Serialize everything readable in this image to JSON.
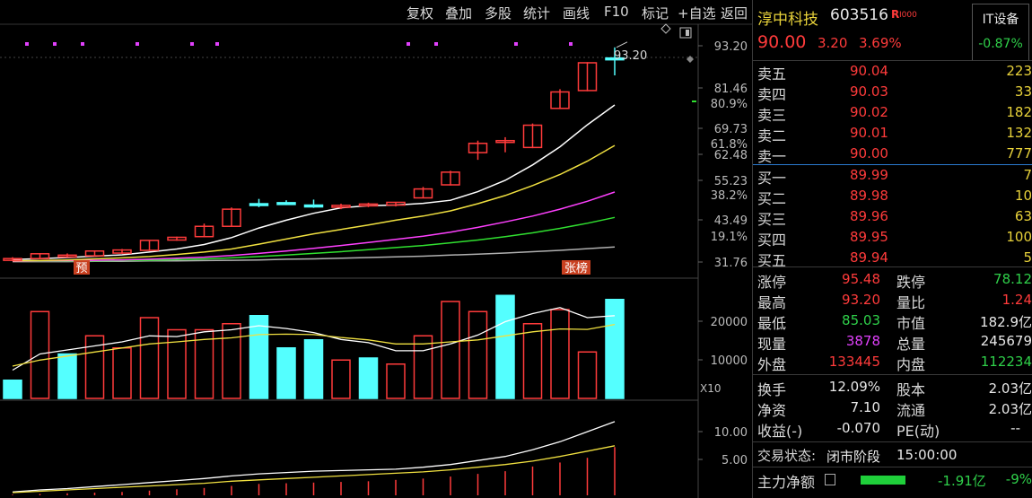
{
  "toolbar": {
    "items": [
      "复权",
      "叠加",
      "多股",
      "统计",
      "画线",
      "F10",
      "标记",
      "+自选",
      "返回"
    ]
  },
  "colors": {
    "up": "#ff3b3b",
    "down": "#54ffff",
    "ma5": "#ffffff",
    "ma10": "#f0e040",
    "ma20": "#ff40ff",
    "ma30": "#30e030",
    "ma60": "#b0b0b0"
  },
  "chart_data": {
    "type": "candlestick",
    "price_axis": {
      "ticks": [
        93.2,
        81.46,
        69.73,
        62.48,
        55.23,
        43.49,
        31.76
      ],
      "ylim": [
        28.5,
        95.5
      ]
    },
    "pct_axis": {
      "ticks": [
        "80.9%",
        "61.8%",
        "38.2%",
        "19.1%"
      ]
    },
    "candles": [
      {
        "o": 31.2,
        "h": 32.0,
        "l": 30.9,
        "c": 31.6
      },
      {
        "o": 31.6,
        "h": 33.2,
        "l": 31.4,
        "c": 33.0
      },
      {
        "o": 32.6,
        "h": 33.1,
        "l": 32.0,
        "c": 32.6
      },
      {
        "o": 32.4,
        "h": 34.0,
        "l": 32.2,
        "c": 33.8
      },
      {
        "o": 33.2,
        "h": 34.4,
        "l": 33.0,
        "c": 34.1
      },
      {
        "o": 34.0,
        "h": 37.0,
        "l": 33.8,
        "c": 36.9
      },
      {
        "o": 37.0,
        "h": 38.0,
        "l": 36.8,
        "c": 37.8
      },
      {
        "o": 38.0,
        "h": 41.8,
        "l": 37.8,
        "c": 41.0
      },
      {
        "o": 41.0,
        "h": 46.5,
        "l": 40.8,
        "c": 46.0
      },
      {
        "o": 47.6,
        "h": 49.0,
        "l": 46.6,
        "c": 47.2
      },
      {
        "o": 47.9,
        "h": 48.6,
        "l": 47.2,
        "c": 47.5
      },
      {
        "o": 47.2,
        "h": 48.8,
        "l": 46.4,
        "c": 46.9
      },
      {
        "o": 46.6,
        "h": 47.6,
        "l": 46.0,
        "c": 47.1
      },
      {
        "o": 47.0,
        "h": 47.9,
        "l": 46.6,
        "c": 47.5
      },
      {
        "o": 47.2,
        "h": 48.1,
        "l": 46.8,
        "c": 48.0
      },
      {
        "o": 49.3,
        "h": 52.5,
        "l": 49.2,
        "c": 51.9
      },
      {
        "o": 53.1,
        "h": 57.2,
        "l": 52.9,
        "c": 56.8
      },
      {
        "o": 62.5,
        "h": 66.0,
        "l": 60.4,
        "c": 65.2
      },
      {
        "o": 66.0,
        "h": 67.0,
        "l": 62.6,
        "c": 66.0
      },
      {
        "o": 64.0,
        "h": 71.0,
        "l": 63.8,
        "c": 70.5
      },
      {
        "o": 75.4,
        "h": 81.0,
        "l": 75.2,
        "c": 80.2
      },
      {
        "o": 80.6,
        "h": 88.9,
        "l": 80.4,
        "c": 88.7
      },
      {
        "o": 90.1,
        "h": 93.2,
        "l": 85.03,
        "c": 90.0
      }
    ],
    "ma5": [
      31.3,
      31.6,
      31.9,
      32.3,
      32.7,
      33.5,
      34.4,
      35.7,
      37.7,
      40.5,
      42.8,
      44.8,
      46.4,
      47.0,
      47.2,
      47.7,
      48.6,
      51.1,
      54.4,
      58.9,
      64.2,
      70.6,
      76.4
    ],
    "ma10": [
      30.9,
      31.0,
      31.2,
      31.5,
      31.8,
      32.2,
      32.8,
      33.5,
      34.4,
      35.8,
      37.3,
      38.8,
      40.1,
      41.4,
      42.8,
      44.0,
      45.5,
      47.6,
      50.0,
      52.9,
      56.1,
      60.0,
      64.6
    ],
    "ma20": [
      30.8,
      30.9,
      31.0,
      31.1,
      31.2,
      31.4,
      31.7,
      32.0,
      32.5,
      33.1,
      33.8,
      34.6,
      35.4,
      36.3,
      37.2,
      38.1,
      39.3,
      40.7,
      42.3,
      44.0,
      46.0,
      48.3,
      51.0
    ],
    "ma30": [
      30.8,
      30.8,
      30.9,
      30.9,
      31.0,
      31.1,
      31.3,
      31.5,
      31.8,
      32.2,
      32.6,
      33.1,
      33.6,
      34.2,
      34.8,
      35.4,
      36.2,
      37.0,
      38.0,
      39.1,
      40.4,
      41.9,
      43.6
    ],
    "ma60": [
      30.7,
      30.7,
      30.7,
      30.8,
      30.8,
      30.9,
      30.9,
      31.0,
      31.1,
      31.2,
      31.4,
      31.5,
      31.7,
      31.9,
      32.1,
      32.3,
      32.6,
      32.9,
      33.2,
      33.6,
      34.0,
      34.5,
      35.0
    ],
    "high_label": "93.20",
    "markers": {
      "yu": "预",
      "zhang": "张榜"
    },
    "volume": {
      "ticks": [
        "20000",
        "10000"
      ],
      "unit": "X10",
      "values": [
        4500,
        21500,
        11000,
        15500,
        12500,
        20000,
        17000,
        17000,
        18500,
        20500,
        12500,
        14500,
        9500,
        10000,
        8500,
        15500,
        24000,
        21500,
        25500,
        18500,
        22000,
        11500,
        24500
      ],
      "down": [
        true,
        false,
        true,
        false,
        false,
        false,
        false,
        false,
        false,
        true,
        true,
        true,
        false,
        true,
        false,
        false,
        false,
        false,
        true,
        false,
        false,
        false,
        true
      ],
      "ma1": [
        7000,
        11000,
        12000,
        13000,
        14000,
        15500,
        15300,
        16500,
        17000,
        18000,
        17300,
        16300,
        14600,
        13800,
        11800,
        11800,
        13500,
        15700,
        19000,
        21000,
        22500,
        20000,
        20500
      ],
      "ma2": [
        8000,
        9500,
        10500,
        11500,
        12500,
        13500,
        14000,
        14600,
        15000,
        15800,
        15900,
        15800,
        15100,
        14500,
        13500,
        13500,
        14000,
        14500,
        15500,
        16500,
        17200,
        17100,
        18300
      ],
      "ylim": [
        0,
        28000
      ]
    },
    "macd": {
      "ticks": [
        "10.00",
        "5.00"
      ],
      "hist": [
        0.1,
        0.2,
        0.3,
        0.4,
        0.5,
        0.7,
        0.9,
        1.1,
        1.4,
        1.7,
        1.8,
        1.9,
        2.0,
        2.1,
        2.3,
        2.5,
        2.8,
        3.2,
        3.6,
        4.3,
        4.9,
        5.6,
        7.2
      ],
      "dif": [
        0.5,
        0.8,
        1.0,
        1.3,
        1.6,
        1.9,
        2.2,
        2.5,
        2.9,
        3.2,
        3.4,
        3.6,
        3.7,
        3.8,
        3.9,
        4.2,
        4.6,
        5.2,
        5.8,
        6.8,
        8.0,
        9.5,
        11.0
      ],
      "dea": [
        0.4,
        0.6,
        0.8,
        1.0,
        1.2,
        1.4,
        1.6,
        1.8,
        2.1,
        2.3,
        2.5,
        2.7,
        2.9,
        3.1,
        3.3,
        3.5,
        3.8,
        4.2,
        4.6,
        5.1,
        5.8,
        6.6,
        7.4
      ],
      "ylim": [
        0,
        13
      ]
    }
  },
  "stock": {
    "name": "淳中科技",
    "code": "603516",
    "badge": "R",
    "badge2": "I000",
    "sector": "IT设备",
    "sector_change": "-0.87%",
    "price": "90.00",
    "change": "3.20",
    "change_pct": "3.69%"
  },
  "orderbook": {
    "asks": [
      {
        "label": "卖五",
        "price": "90.04",
        "vol": "223"
      },
      {
        "label": "卖四",
        "price": "90.03",
        "vol": "33"
      },
      {
        "label": "卖三",
        "price": "90.02",
        "vol": "182"
      },
      {
        "label": "卖二",
        "price": "90.01",
        "vol": "132"
      },
      {
        "label": "卖一",
        "price": "90.00",
        "vol": "777"
      }
    ],
    "bids": [
      {
        "label": "买一",
        "price": "89.99",
        "vol": "7"
      },
      {
        "label": "买二",
        "price": "89.98",
        "vol": "10"
      },
      {
        "label": "买三",
        "price": "89.96",
        "vol": "63"
      },
      {
        "label": "买四",
        "price": "89.95",
        "vol": "100"
      },
      {
        "label": "买五",
        "price": "89.94",
        "vol": "5"
      }
    ]
  },
  "stats": {
    "zt_label": "涨停",
    "zt": "95.48",
    "dt_label": "跌停",
    "dt": "78.12",
    "high_label": "最高",
    "high": "93.20",
    "lb_label": "量比",
    "lb": "1.24",
    "low_label": "最低",
    "low": "85.03",
    "mv_label": "市值",
    "mv": "182.9亿",
    "xl_label": "现量",
    "xl": "3878",
    "zl_label": "总量",
    "zl": "245679",
    "wp_label": "外盘",
    "wp": "133445",
    "np_label": "内盘",
    "np": "112234",
    "hs_label": "换手",
    "hs": "12.09%",
    "gb_label": "股本",
    "gb": "2.03亿",
    "jz_label": "净资",
    "jz": "7.10",
    "lt_label": "流通",
    "lt": "2.03亿",
    "sy_label": "收益(-)",
    "sy": "-0.070",
    "pe_label": "PE(动)",
    "pe": "--"
  },
  "trade_state": {
    "label": "交易状态:",
    "value": "闭市阶段",
    "time": "15:00:00"
  },
  "main_force": {
    "label": "主力净额",
    "value": "-1.91亿",
    "pct": "-9%"
  }
}
